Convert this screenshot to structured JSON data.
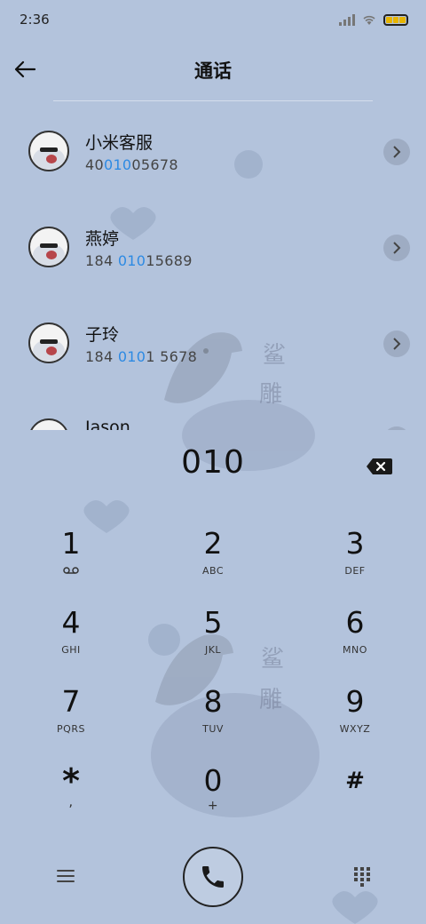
{
  "status": {
    "time": "2:36"
  },
  "header": {
    "title": "通话",
    "back_icon": "arrow-left-icon"
  },
  "contacts": [
    {
      "name": "小米客服",
      "num_pre": "40",
      "num_hl": "010",
      "num_post": "05678"
    },
    {
      "name": "燕婷",
      "num_pre": "184 ",
      "num_hl": "010",
      "num_post": "15689"
    },
    {
      "name": "子玲",
      "num_pre": "184 ",
      "num_hl": "010",
      "num_post": "1 5678"
    },
    {
      "name": "Jason",
      "num_pre": "",
      "num_hl": "",
      "num_post": ""
    }
  ],
  "dialer": {
    "input": "010"
  },
  "keys": [
    {
      "digit": "1",
      "letters": ""
    },
    {
      "digit": "2",
      "letters": "ABC"
    },
    {
      "digit": "3",
      "letters": "DEF"
    },
    {
      "digit": "4",
      "letters": "GHI"
    },
    {
      "digit": "5",
      "letters": "JKL"
    },
    {
      "digit": "6",
      "letters": "MNO"
    },
    {
      "digit": "7",
      "letters": "PQRS"
    },
    {
      "digit": "8",
      "letters": "TUV"
    },
    {
      "digit": "9",
      "letters": "WXYZ"
    },
    {
      "digit": "*",
      "letters": ","
    },
    {
      "digit": "0",
      "letters": "+"
    },
    {
      "digit": "#",
      "letters": ""
    }
  ],
  "background_text": [
    "鲨",
    "雕"
  ],
  "colors": {
    "background": "#b3c3dc",
    "highlight": "#2d8ae3"
  }
}
